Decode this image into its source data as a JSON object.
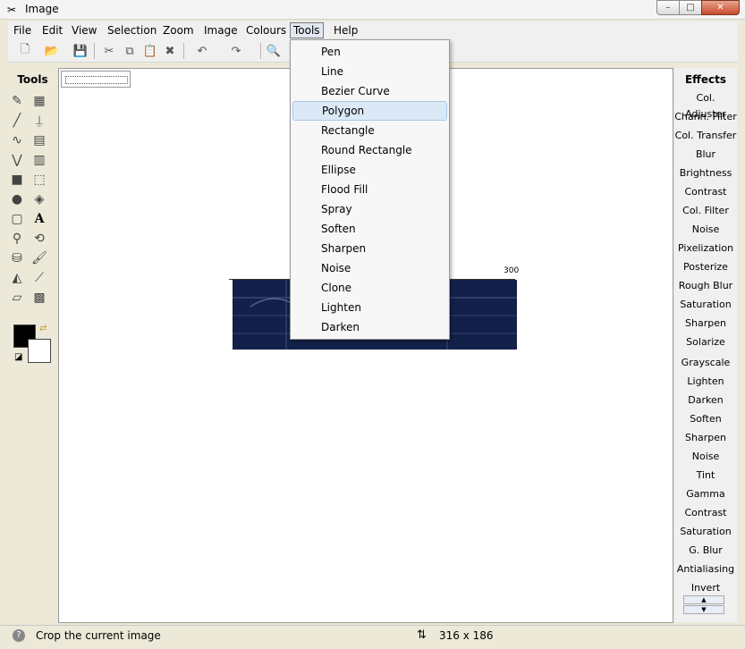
{
  "window": {
    "title": "Image"
  },
  "titlebar": {
    "min": "–",
    "max": "□",
    "close": "✕"
  },
  "menubar": [
    "File",
    "Edit",
    "View",
    "Selection",
    "Zoom",
    "Image",
    "Colours",
    "Tools",
    "Help"
  ],
  "left_panel": {
    "title": "Tools"
  },
  "right_panel": {
    "title": "Effects",
    "items": [
      "Col. Adjuster",
      "Chann. Filter",
      "Col. Transfer",
      "Blur",
      "Brightness",
      "Contrast",
      "Col. Filter",
      "Noise",
      "Pixelization",
      "Posterize",
      "Rough Blur",
      "Saturation",
      "Sharpen",
      "Solarize",
      "Grayscale",
      "Lighten",
      "Darken",
      "Soften",
      "Sharpen",
      "Noise",
      "Tint",
      "Gamma",
      "Contrast",
      "Saturation",
      "G. Blur",
      "Antialiasing",
      "Invert"
    ]
  },
  "tools_menu": {
    "items": [
      "Pen",
      "Line",
      "Bezier Curve",
      "Polygon",
      "Rectangle",
      "Round Rectangle",
      "Ellipse",
      "Flood Fill",
      "Spray",
      "Soften",
      "Sharpen",
      "Noise",
      "Clone",
      "Lighten",
      "Darken"
    ],
    "highlighted": "Polygon"
  },
  "canvas": {
    "ruler_label": "300"
  },
  "status": {
    "text": "Crop the current image",
    "size": "316 x 186"
  }
}
